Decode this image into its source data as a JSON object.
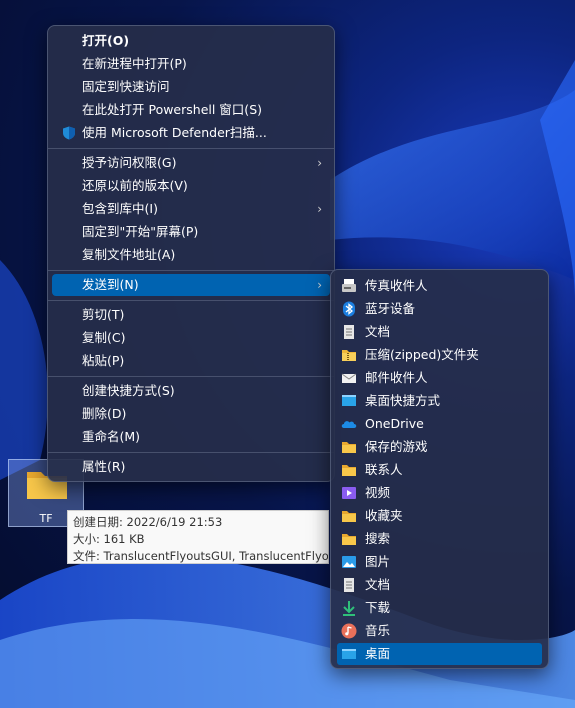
{
  "desktop": {
    "icon_label": "TF"
  },
  "tooltip": {
    "line1": "创建日期: 2022/6/19 21:53",
    "line2": "大小: 161 KB",
    "line3": "文件: TranslucentFlyoutsGUI, TranslucentFlyo"
  },
  "context_menu": {
    "items": [
      {
        "label": "打开(O)"
      },
      {
        "label": "在新进程中打开(P)"
      },
      {
        "label": "固定到快速访问"
      },
      {
        "label": "在此处打开 Powershell 窗口(S)"
      },
      {
        "label": "使用 Microsoft Defender扫描..."
      },
      {
        "label": "授予访问权限(G)"
      },
      {
        "label": "还原以前的版本(V)"
      },
      {
        "label": "包含到库中(I)"
      },
      {
        "label": "固定到\"开始\"屏幕(P)"
      },
      {
        "label": "复制文件地址(A)"
      },
      {
        "label": "发送到(N)"
      },
      {
        "label": "剪切(T)"
      },
      {
        "label": "复制(C)"
      },
      {
        "label": "粘贴(P)"
      },
      {
        "label": "创建快捷方式(S)"
      },
      {
        "label": "删除(D)"
      },
      {
        "label": "重命名(M)"
      },
      {
        "label": "属性(R)"
      }
    ],
    "arrow": "›"
  },
  "send_to_menu": {
    "items": [
      {
        "label": "传真收件人",
        "icon": "fax-icon"
      },
      {
        "label": "蓝牙设备",
        "icon": "bluetooth-icon"
      },
      {
        "label": "文档",
        "icon": "document-icon"
      },
      {
        "label": "压缩(zipped)文件夹",
        "icon": "zip-folder-icon"
      },
      {
        "label": "邮件收件人",
        "icon": "mail-icon"
      },
      {
        "label": "桌面快捷方式",
        "icon": "desktop-shortcut-icon"
      },
      {
        "label": "OneDrive",
        "icon": "onedrive-icon"
      },
      {
        "label": "保存的游戏",
        "icon": "folder-icon"
      },
      {
        "label": "联系人",
        "icon": "folder-icon"
      },
      {
        "label": "视频",
        "icon": "video-icon"
      },
      {
        "label": "收藏夹",
        "icon": "folder-icon"
      },
      {
        "label": "搜索",
        "icon": "folder-icon"
      },
      {
        "label": "图片",
        "icon": "pictures-icon"
      },
      {
        "label": "文档",
        "icon": "document-icon"
      },
      {
        "label": "下载",
        "icon": "download-icon"
      },
      {
        "label": "音乐",
        "icon": "music-icon"
      },
      {
        "label": "桌面",
        "icon": "desktop-icon"
      }
    ]
  },
  "colors": {
    "highlight": "#0063b1",
    "menu_bg": "#262e4a",
    "folder": "#f8c74a"
  }
}
